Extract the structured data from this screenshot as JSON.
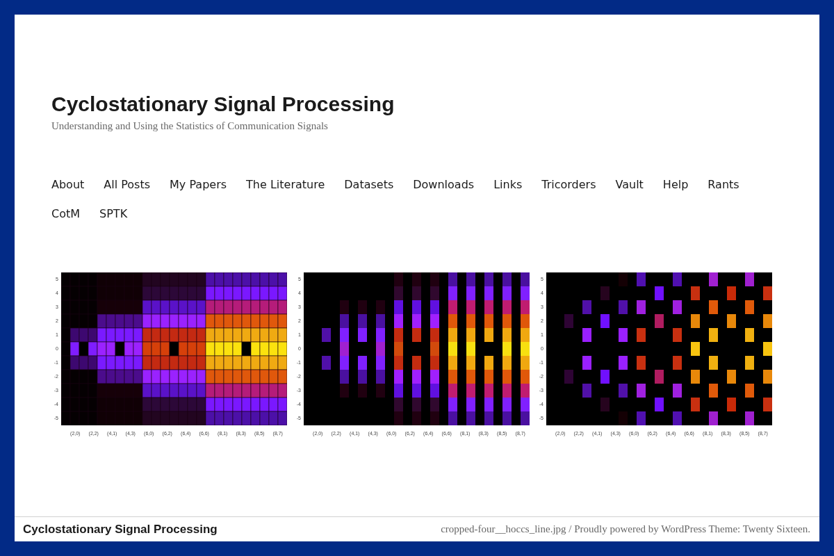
{
  "site": {
    "title": "Cyclostationary Signal Processing",
    "tagline": "Understanding and Using the Statistics of Communication Signals"
  },
  "menu": [
    "About",
    "All Posts",
    "My Papers",
    "The Literature",
    "Datasets",
    "Downloads",
    "Links",
    "Tricorders",
    "Vault",
    "Help",
    "Rants",
    "CotM",
    "SPTK"
  ],
  "header_image": {
    "panels": [
      {
        "kind": "solid",
        "y_labels": [
          "5",
          "4",
          "3",
          "2",
          "1",
          "0",
          "-1",
          "-2",
          "-3",
          "-4",
          "-5"
        ],
        "x_labels": [
          "(2,0)",
          "(2,2)",
          "(4,1)",
          "(4,3)",
          "(6,0)",
          "(6,2)",
          "(6,4)",
          "(6,6)",
          "(8,1)",
          "(8,3)",
          "(8,5)",
          "(8,7)"
        ]
      },
      {
        "kind": "striped",
        "y_labels": [
          "5",
          "4",
          "3",
          "2",
          "1",
          "0",
          "-1",
          "-2",
          "-3",
          "-4",
          "-5"
        ],
        "x_labels": [
          "(2,0)",
          "(2,2)",
          "(4,1)",
          "(4,3)",
          "(6,0)",
          "(6,2)",
          "(6,4)",
          "(6,6)",
          "(8,1)",
          "(8,3)",
          "(8,5)",
          "(8,7)"
        ]
      },
      {
        "kind": "sparse",
        "y_labels": [
          "5",
          "4",
          "3",
          "2",
          "1",
          "0",
          "-1",
          "-2",
          "-3",
          "-4",
          "-5"
        ],
        "x_labels": [
          "(2,0)",
          "(2,2)",
          "(4,1)",
          "(4,3)",
          "(6,0)",
          "(6,2)",
          "(6,4)",
          "(6,6)",
          "(8,1)",
          "(8,3)",
          "(8,5)",
          "(8,7)"
        ]
      }
    ]
  },
  "footer": {
    "site_title": "Cyclostationary Signal Processing",
    "credits": "cropped-four__hoccs_line.jpg / Proudly powered by WordPress Theme: Twenty Sixteen."
  }
}
